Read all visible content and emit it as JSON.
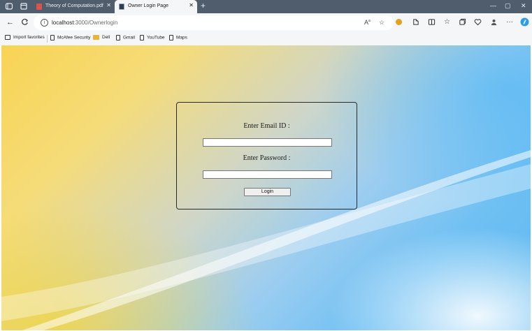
{
  "browser": {
    "tabs": [
      {
        "title": "Theory of Computation.pdf",
        "icon": "pdf-icon",
        "active": false
      },
      {
        "title": "Owner Login Page",
        "icon": "page-icon",
        "active": true
      }
    ],
    "new_tab_glyph": "+",
    "window_controls": {
      "minimize": "—",
      "maximize": "▢",
      "close": "✕"
    },
    "url": {
      "host": "localhost",
      "path": ":3000/Ownerlogin"
    },
    "favorites": [
      {
        "label": "Import favorites",
        "icon": "import-icon"
      },
      {
        "label": "McAfee Security",
        "icon": "page-icon"
      },
      {
        "label": "Dell",
        "icon": "folder-icon"
      },
      {
        "label": "Gmail",
        "icon": "page-icon"
      },
      {
        "label": "YouTube",
        "icon": "page-icon"
      },
      {
        "label": "Maps",
        "icon": "page-icon"
      }
    ]
  },
  "login": {
    "email_label": "Enter Email ID :",
    "email_value": "",
    "password_label": "Enter Password :",
    "password_value": "",
    "button_label": "Login"
  },
  "colors": {
    "tabstrip": "#4f5d6d",
    "toolbar": "#f5f6f8",
    "box_border": "#2a2a2a"
  }
}
